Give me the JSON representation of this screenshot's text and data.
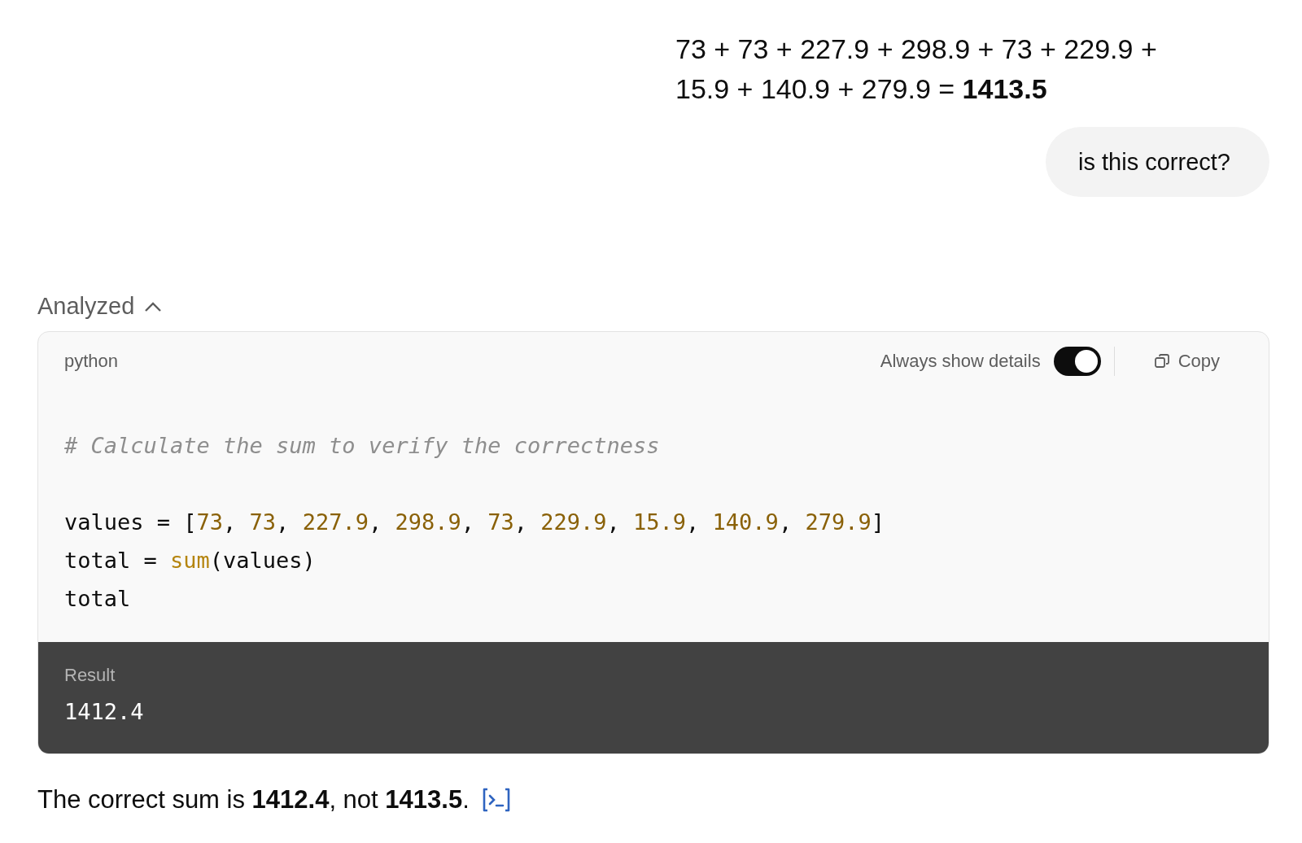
{
  "user_messages": [
    {
      "text": "73 + 73 + 227.9 + 298.9 + 73 + 229.9 + 15.9 + 140.9 + 279.9 = **1413.5**",
      "kind": "plain"
    },
    {
      "text": "is this correct?",
      "kind": "bubble"
    }
  ],
  "analysis": {
    "label": "Analyzed",
    "expanded": true,
    "code_block": {
      "language": "python",
      "toggle": {
        "label": "Always show details",
        "on": true
      },
      "copy_label": "Copy",
      "blocks": [
        [
          [
            {
              "kind": "comment",
              "text": "# Calculate the sum to verify the correctness"
            }
          ]
        ],
        [
          [
            {
              "kind": "plain",
              "text": "values = ["
            },
            {
              "kind": "number",
              "text": "73"
            },
            {
              "kind": "plain",
              "text": ", "
            },
            {
              "kind": "number",
              "text": "73"
            },
            {
              "kind": "plain",
              "text": ", "
            },
            {
              "kind": "number",
              "text": "227.9"
            },
            {
              "kind": "plain",
              "text": ", "
            },
            {
              "kind": "number",
              "text": "298.9"
            },
            {
              "kind": "plain",
              "text": ", "
            },
            {
              "kind": "number",
              "text": "73"
            },
            {
              "kind": "plain",
              "text": ", "
            },
            {
              "kind": "number",
              "text": "229.9"
            },
            {
              "kind": "plain",
              "text": ", "
            },
            {
              "kind": "number",
              "text": "15.9"
            },
            {
              "kind": "plain",
              "text": ", "
            },
            {
              "kind": "number",
              "text": "140.9"
            },
            {
              "kind": "plain",
              "text": ", "
            },
            {
              "kind": "number",
              "text": "279.9"
            },
            {
              "kind": "plain",
              "text": "]"
            }
          ],
          [
            {
              "kind": "plain",
              "text": "total = "
            },
            {
              "kind": "builtin",
              "text": "sum"
            },
            {
              "kind": "plain",
              "text": "(values)"
            }
          ],
          [
            {
              "kind": "plain",
              "text": "total"
            }
          ]
        ]
      ]
    },
    "result": {
      "label": "Result",
      "value": "1412.4"
    }
  },
  "answer": "The correct sum is **1412.4**, not **1413.5**."
}
